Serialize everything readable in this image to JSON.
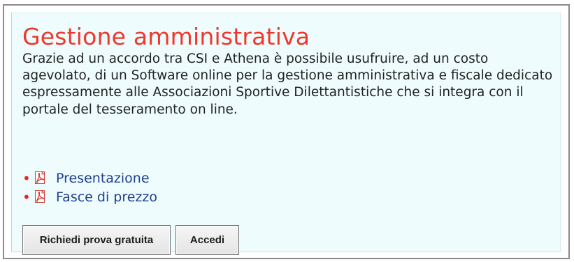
{
  "section": {
    "title": "Gestione amministrativa",
    "description": "Grazie ad un accordo tra CSI e Athena è possibile usufruire, ad un costo agevolato, di un Software online per la gestione amministrativa e fiscale dedicato espressamente alle Associazioni Sportive Dilettantistiche che si integra con il portale del tesseramento on line."
  },
  "documents": [
    {
      "label": "Presentazione",
      "icon": "pdf-icon"
    },
    {
      "label": "Fasce di prezzo",
      "icon": "pdf-icon"
    }
  ],
  "buttons": {
    "trial_label": "Richiedi prova gratuita",
    "login_label": "Accedi"
  },
  "colors": {
    "title": "#f0372c",
    "panel_background": "#eefcfd",
    "link": "#1f3f8f",
    "bullet": "#e9261e"
  }
}
